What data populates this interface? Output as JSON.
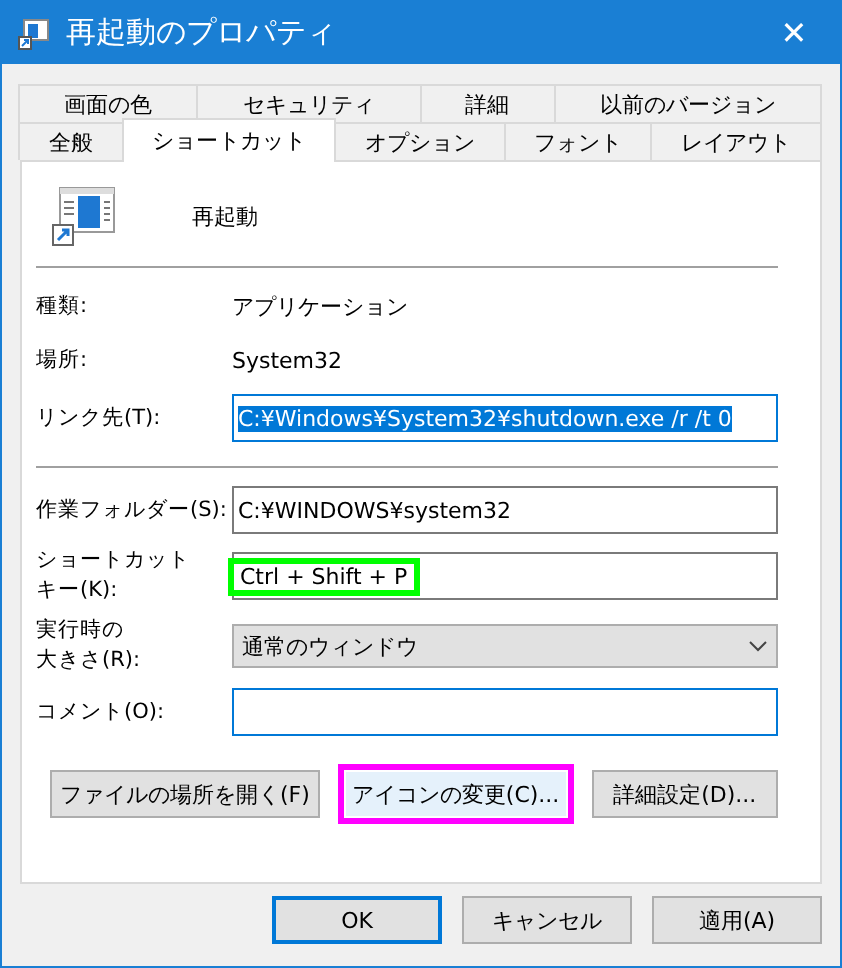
{
  "window": {
    "title": "再起動のプロパティ",
    "close": "✕"
  },
  "tabs": [
    [
      {
        "label": "画面の色",
        "selected": false
      },
      {
        "label": "セキュリティ",
        "selected": false
      },
      {
        "label": "詳細",
        "selected": false
      },
      {
        "label": "以前のバージョン",
        "selected": false
      }
    ],
    [
      {
        "label": "全般",
        "selected": false
      },
      {
        "label": "ショートカット",
        "selected": true
      },
      {
        "label": "オプション",
        "selected": false
      },
      {
        "label": "フォント",
        "selected": false
      },
      {
        "label": "レイアウト",
        "selected": false
      }
    ]
  ],
  "shortcut_name": "再起動",
  "groups": [
    [
      {
        "kind": "text",
        "label": [
          "種類:"
        ],
        "value": "アプリケーション"
      },
      {
        "kind": "text",
        "label": [
          "場所:"
        ],
        "value": "System32"
      },
      {
        "kind": "field",
        "label": [
          "リンク先(T):"
        ],
        "value": "C:¥Windows¥System32¥shutdown.exe /r /t 0",
        "focused": true,
        "text_selected": true
      }
    ],
    [
      {
        "kind": "field",
        "label": [
          "作業フォルダー(S):"
        ],
        "value": "C:¥WINDOWS¥system32",
        "focused": false
      },
      {
        "kind": "field",
        "label": [
          "ショートカット",
          "キー(K):"
        ],
        "value": "Ctrl + Shift + P",
        "focused": false,
        "color": "#00ff00"
      },
      {
        "kind": "select",
        "label": [
          "実行時の",
          "大きさ(R):"
        ],
        "value": "通常のウィンドウ"
      },
      {
        "kind": "field",
        "label": [
          "コメント(O):"
        ],
        "focused": true
      }
    ]
  ],
  "actions": [
    {
      "label": "ファイルの場所を開く(F)"
    },
    {
      "label": "アイコンの変更(C)...",
      "color": "#ff00ff"
    },
    {
      "label": "詳細設定(D)..."
    }
  ],
  "buttons": [
    {
      "label": "OK",
      "default": true
    },
    {
      "label": "キャンセル",
      "default": false
    },
    {
      "label": "適用(A)",
      "default": false
    }
  ]
}
